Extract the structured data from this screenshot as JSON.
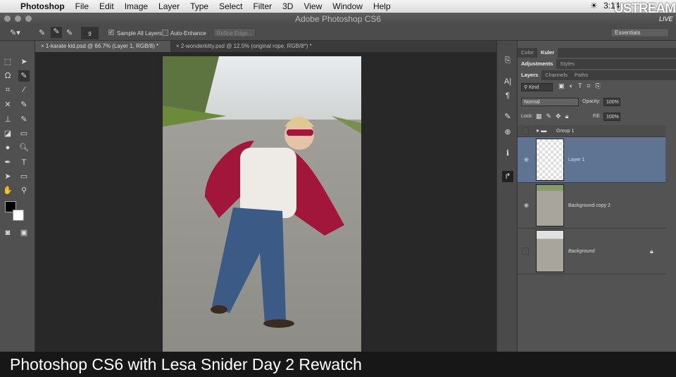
{
  "menubar": {
    "app": "Photoshop",
    "items": [
      "File",
      "Edit",
      "Image",
      "Layer",
      "Type",
      "Select",
      "Filter",
      "3D",
      "View",
      "Window",
      "Help"
    ],
    "clock": "3:14"
  },
  "window": {
    "title": "Adobe Photoshop CS6"
  },
  "options": {
    "brush_size": "9",
    "sample_all_layers": "Sample All Layers",
    "sample_all_checked": true,
    "auto_enhance": "Auto-Enhance",
    "auto_enhance_checked": false,
    "refine_edge": "Refine Edge...",
    "workspace": "Essentials"
  },
  "tabs": [
    {
      "label": "1-karate kid.psd @ 66.7% (Layer 1, RGB/8) *",
      "active": true
    },
    {
      "label": "2-wonderkitty.psd @ 12.5% (original rope, RGB/8*) *",
      "active": false
    }
  ],
  "panels": {
    "group1": [
      "Color",
      "Kuler"
    ],
    "group2": [
      "Adjustments",
      "Styles"
    ],
    "group3": [
      "Layers",
      "Channels",
      "Paths"
    ],
    "filter": "Kind",
    "blend_mode": "Normal",
    "opacity_label": "Opacity:",
    "opacity": "100%",
    "lock_label": "Lock:",
    "fill_label": "Fill:",
    "fill": "100%",
    "layers": [
      {
        "name": "Group 1",
        "visible": false,
        "selected": false
      },
      {
        "name": "Layer 1",
        "visible": true,
        "selected": true
      },
      {
        "name": "Background copy 2",
        "visible": true,
        "selected": false
      },
      {
        "name": "Background",
        "visible": false,
        "selected": false,
        "locked": true
      }
    ]
  },
  "watermark": {
    "brand": "USTREAM",
    "sub": "LIVE"
  },
  "caption": "Photoshop CS6 with Lesa Snider Day 2 Rewatch",
  "colors": {
    "selected_layer": "#5f7393",
    "cape": "#a3163c"
  }
}
